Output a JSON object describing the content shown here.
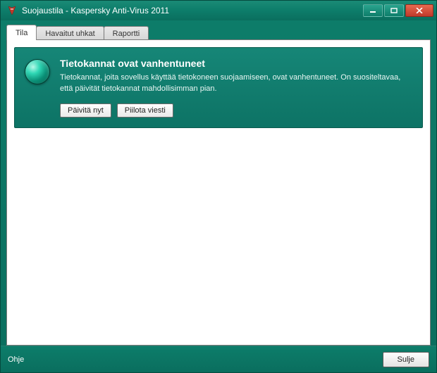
{
  "window": {
    "title": "Suojaustila - Kaspersky Anti-Virus 2011"
  },
  "tabs": [
    {
      "label": "Tila",
      "active": true
    },
    {
      "label": "Havaitut uhkat",
      "active": false
    },
    {
      "label": "Raportti",
      "active": false
    }
  ],
  "alert": {
    "heading": "Tietokannat ovat vanhentuneet",
    "body": "Tietokannat, joita sovellus käyttää tietokoneen suojaamiseen, ovat vanhentuneet. On suositeltavaa, että päivität tietokannat mahdollisimman pian.",
    "buttons": {
      "update": "Päivitä nyt",
      "hide": "Piilota viesti"
    }
  },
  "footer": {
    "help": "Ohje",
    "close": "Sulje"
  }
}
